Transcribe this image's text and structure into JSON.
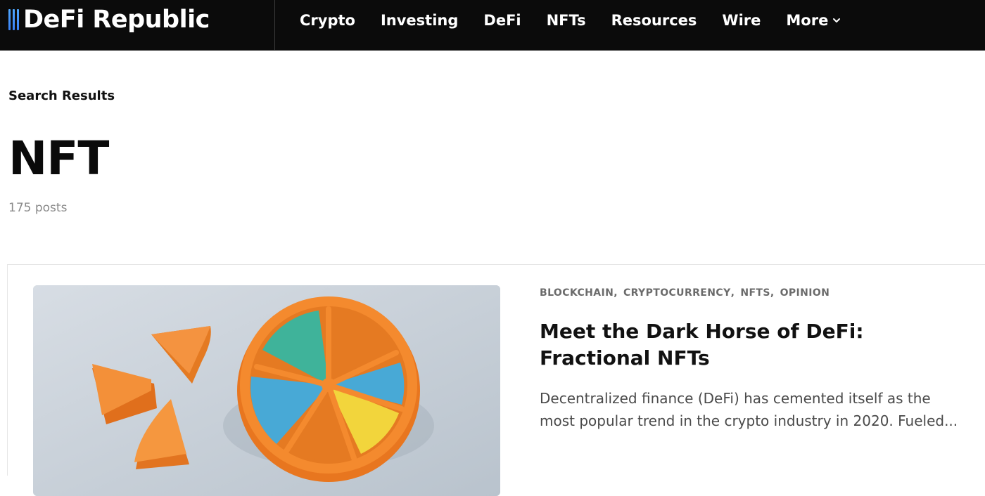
{
  "header": {
    "logo_text": "DeFi Republic",
    "nav": [
      {
        "label": "Crypto"
      },
      {
        "label": "Investing"
      },
      {
        "label": "DeFi"
      },
      {
        "label": "NFTs"
      },
      {
        "label": "Resources"
      },
      {
        "label": "Wire"
      },
      {
        "label": "More"
      }
    ]
  },
  "search": {
    "breadcrumb": "Search Results",
    "query": "NFT",
    "count": "175 posts"
  },
  "results": [
    {
      "categories": [
        "BLOCKCHAIN",
        "CRYPTOCURRENCY",
        "NFTS",
        "OPINION"
      ],
      "title": "Meet the Dark Horse of DeFi: Fractional NFTs",
      "excerpt": "Decentralized finance (DeFi) has cemented itself as the most popular trend in the crypto industry in 2020. Fueled..."
    }
  ],
  "colors": {
    "header_bg": "#0b0b0b",
    "accent": "#3b82f6",
    "orange": "#f08a2c",
    "teal": "#3fb39a",
    "blue": "#48a9d6",
    "yellow": "#f2d53c"
  }
}
